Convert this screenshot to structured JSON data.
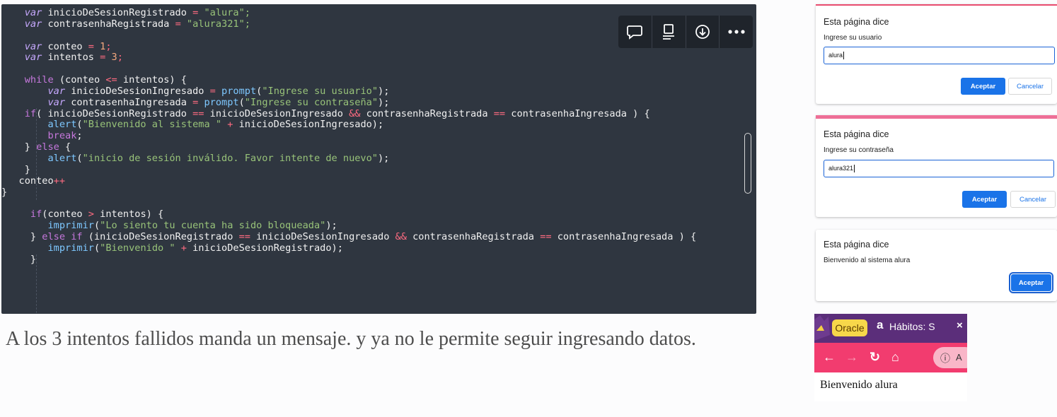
{
  "code_lines": [
    [
      [
        "    ",
        "pl"
      ],
      [
        "var",
        "it"
      ],
      [
        " inicioDeSesionRegistrado ",
        "pl"
      ],
      [
        "=",
        "op"
      ],
      [
        " \"alura\";",
        "str"
      ]
    ],
    [
      [
        "    ",
        "pl"
      ],
      [
        "var",
        "it"
      ],
      [
        " contrasenhaRegistrada ",
        "pl"
      ],
      [
        "=",
        "op"
      ],
      [
        " \"alura321\";",
        "str"
      ]
    ],
    [
      [
        "",
        "pl"
      ]
    ],
    [
      [
        "    ",
        "pl"
      ],
      [
        "var",
        "it"
      ],
      [
        " conteo ",
        "pl"
      ],
      [
        "=",
        "op"
      ],
      [
        " ",
        "pl"
      ],
      [
        "1",
        "num"
      ],
      [
        ";",
        "op"
      ]
    ],
    [
      [
        "    ",
        "pl"
      ],
      [
        "var",
        "it"
      ],
      [
        " intentos ",
        "pl"
      ],
      [
        "=",
        "op"
      ],
      [
        " ",
        "pl"
      ],
      [
        "3",
        "num"
      ],
      [
        ";",
        "op"
      ]
    ],
    [
      [
        "",
        "pl"
      ]
    ],
    [
      [
        "    ",
        "pl"
      ],
      [
        "while",
        "kw"
      ],
      [
        " (conteo ",
        "pl"
      ],
      [
        "<=",
        "op"
      ],
      [
        " intentos) {",
        "pl"
      ]
    ],
    [
      [
        "        ",
        "pl"
      ],
      [
        "var",
        "it"
      ],
      [
        " inicioDeSesionIngresado ",
        "pl"
      ],
      [
        "=",
        "op"
      ],
      [
        " ",
        "pl"
      ],
      [
        "prompt",
        "fn"
      ],
      [
        "(",
        "pl"
      ],
      [
        "\"Ingrese su usuario\"",
        "str"
      ],
      [
        ");",
        "pl"
      ]
    ],
    [
      [
        "        ",
        "pl"
      ],
      [
        "var",
        "it"
      ],
      [
        " contrasenhaIngresada ",
        "pl"
      ],
      [
        "=",
        "op"
      ],
      [
        " ",
        "pl"
      ],
      [
        "prompt",
        "fn"
      ],
      [
        "(",
        "pl"
      ],
      [
        "\"Ingrese su contraseña\"",
        "str"
      ],
      [
        ");",
        "pl"
      ]
    ],
    [
      [
        "    ",
        "pl"
      ],
      [
        "if",
        "kw"
      ],
      [
        "( inicioDeSesionRegistrado ",
        "pl"
      ],
      [
        "==",
        "op"
      ],
      [
        " inicioDeSesionIngresado ",
        "pl"
      ],
      [
        "&&",
        "op"
      ],
      [
        " contrasenhaRegistrada ",
        "pl"
      ],
      [
        "==",
        "op"
      ],
      [
        " contrasenhaIngresada ) {",
        "pl"
      ]
    ],
    [
      [
        "        ",
        "pl"
      ],
      [
        "alert",
        "fn"
      ],
      [
        "(",
        "pl"
      ],
      [
        "\"Bienvenido al sistema \"",
        "str"
      ],
      [
        " ",
        "pl"
      ],
      [
        "+",
        "op"
      ],
      [
        " inicioDeSesionIngresado);",
        "pl"
      ]
    ],
    [
      [
        "        ",
        "pl"
      ],
      [
        "break",
        "kw"
      ],
      [
        ";",
        "pl"
      ]
    ],
    [
      [
        "    } ",
        "pl"
      ],
      [
        "else",
        "kw"
      ],
      [
        " {",
        "pl"
      ]
    ],
    [
      [
        "        ",
        "pl"
      ],
      [
        "alert",
        "fn"
      ],
      [
        "(",
        "pl"
      ],
      [
        "\"inicio de sesión inválido. Favor intente de nuevo\"",
        "str"
      ],
      [
        ");",
        "pl"
      ]
    ],
    [
      [
        "    }",
        "pl"
      ]
    ],
    [
      [
        "   conteo",
        "pl"
      ],
      [
        "++",
        "op"
      ]
    ],
    [
      [
        "}",
        "pl"
      ]
    ],
    [
      [
        "",
        "pl"
      ]
    ],
    [
      [
        "     ",
        "pl"
      ],
      [
        "if",
        "kw"
      ],
      [
        "(conteo ",
        "pl"
      ],
      [
        ">",
        "op"
      ],
      [
        " intentos) {",
        "pl"
      ]
    ],
    [
      [
        "        ",
        "pl"
      ],
      [
        "imprimir",
        "fn"
      ],
      [
        "(",
        "pl"
      ],
      [
        "\"Lo siento tu cuenta ha sido bloqueada\"",
        "str"
      ],
      [
        ");",
        "pl"
      ]
    ],
    [
      [
        "     } ",
        "pl"
      ],
      [
        "else if",
        "kw"
      ],
      [
        " (inicioDeSesionRegistrado ",
        "pl"
      ],
      [
        "==",
        "op"
      ],
      [
        " inicioDeSesionIngresado ",
        "pl"
      ],
      [
        "&&",
        "op"
      ],
      [
        " contrasenhaRegistrada ",
        "pl"
      ],
      [
        "==",
        "op"
      ],
      [
        " contrasenhaIngresada ) {",
        "pl"
      ]
    ],
    [
      [
        "        ",
        "pl"
      ],
      [
        "imprimir",
        "fn"
      ],
      [
        "(",
        "pl"
      ],
      [
        "\"Bienvenido \"",
        "str"
      ],
      [
        " ",
        "pl"
      ],
      [
        "+",
        "op"
      ],
      [
        " inicioDeSesionRegistrado);",
        "pl"
      ]
    ],
    [
      [
        "     }",
        "pl"
      ]
    ]
  ],
  "toolbar": {
    "icons": [
      "comment-icon",
      "document-icon",
      "download-icon",
      "more-icon"
    ]
  },
  "caption": {
    "text": "A los 3 intentos fallidos  manda un mensaje. y ya no le permite seguir ingresando datos."
  },
  "dialogs": {
    "user": {
      "title": "Esta página dice",
      "message": "Ingrese su usuario",
      "value": "alura",
      "ok": "Aceptar",
      "cancel": "Cancelar"
    },
    "password": {
      "title": "Esta página dice",
      "message": "Ingrese su contraseña",
      "value": "alura321",
      "ok": "Aceptar",
      "cancel": "Cancelar"
    },
    "alert": {
      "title": "Esta página dice",
      "message": "Bienvenido al sistema alura",
      "ok": "Aceptar"
    }
  },
  "browser": {
    "tab_oracle": "Oracle",
    "tab_alura_icon": "a",
    "tab_alura": "Hábitos: S",
    "tab_close": "×",
    "page_text": "Bienvenido alura"
  },
  "colors": {
    "code_bg": "#2f3640",
    "accent_blue": "#1a73e8",
    "browser_nav": "#f23c6f",
    "browser_tabstrip": "#5b2e7a"
  }
}
